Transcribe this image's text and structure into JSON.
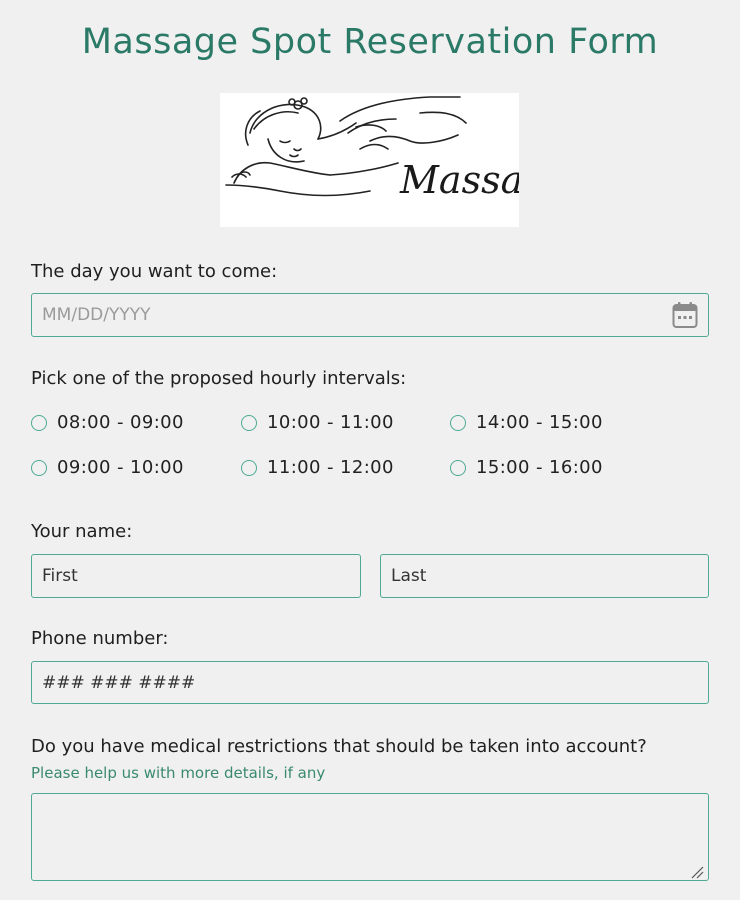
{
  "page": {
    "title": "Massage Spot Reservation Form"
  },
  "logo": {
    "text": "Massage"
  },
  "date": {
    "label": "The day you want to come:",
    "placeholder": "MM/DD/YYYY",
    "icon": "calendar-icon"
  },
  "interval": {
    "label": "Pick one of the proposed hourly intervals:",
    "options": [
      "08:00 - 09:00",
      "10:00 - 11:00",
      "14:00 - 15:00",
      "09:00 - 10:00",
      "11:00 - 12:00",
      "15:00 - 16:00"
    ]
  },
  "name": {
    "label": "Your name:",
    "first_placeholder": "First",
    "last_placeholder": "Last"
  },
  "phone": {
    "label": "Phone number:",
    "placeholder": "### ### ####"
  },
  "medical": {
    "label": "Do you have medical restrictions that should be taken into account?",
    "sublabel": "Please help us with more details, if any",
    "value": ""
  },
  "colors": {
    "accent": "#2b7a67",
    "border": "#4fa995",
    "background": "#f0f0f0"
  }
}
